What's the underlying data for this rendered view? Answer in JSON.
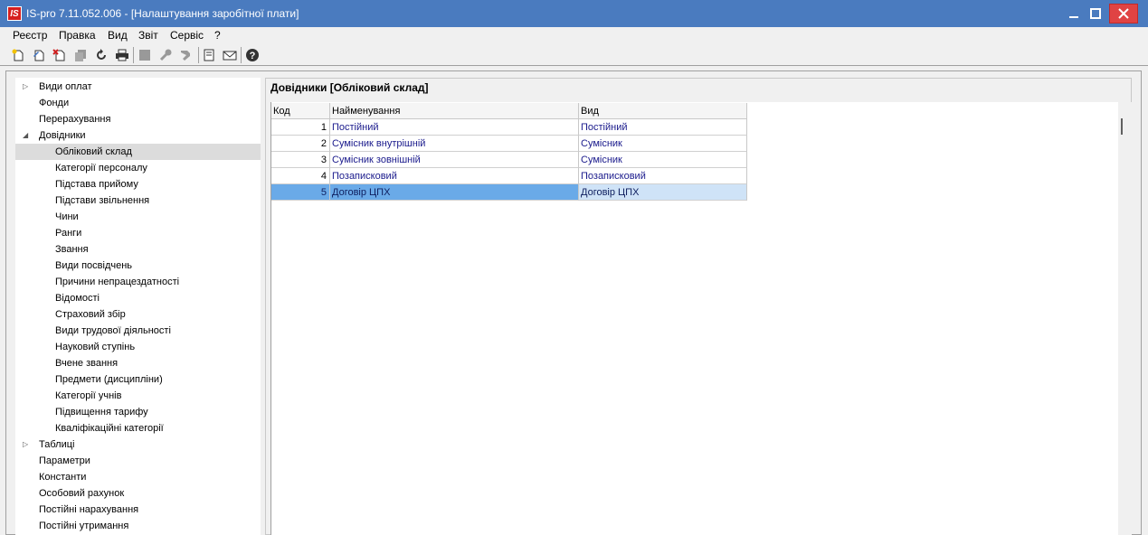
{
  "window": {
    "logo": "IS",
    "title": "IS-pro 7.11.052.006 - [Налаштування заробітної плати]"
  },
  "menu": [
    "Реєстр",
    "Правка",
    "Вид",
    "Звіт",
    "Сервіс",
    "?"
  ],
  "toolbar": {
    "icons": [
      "new-doc-icon",
      "edit-doc-icon",
      "delete-doc-icon",
      "copy-icon",
      "refresh-icon",
      "print-icon",
      "square-icon",
      "wrench-icon",
      "tool-icon",
      "document-icon",
      "envelope-icon",
      "help-icon"
    ]
  },
  "tree": {
    "items": [
      {
        "label": "Види оплат",
        "level": 0,
        "expander": "collapsed"
      },
      {
        "label": "Фонди",
        "level": 0,
        "expander": "none"
      },
      {
        "label": "Перерахування",
        "level": 0,
        "expander": "none"
      },
      {
        "label": "Довідники",
        "level": 0,
        "expander": "expanded"
      },
      {
        "label": "Обліковий склад",
        "level": 1,
        "expander": "none",
        "selected": true
      },
      {
        "label": "Категорії персоналу",
        "level": 1,
        "expander": "none"
      },
      {
        "label": "Підстава прийому",
        "level": 1,
        "expander": "none"
      },
      {
        "label": "Підстави звільнення",
        "level": 1,
        "expander": "none"
      },
      {
        "label": "Чини",
        "level": 1,
        "expander": "none"
      },
      {
        "label": "Ранги",
        "level": 1,
        "expander": "none"
      },
      {
        "label": "Звання",
        "level": 1,
        "expander": "none"
      },
      {
        "label": "Види посвідчень",
        "level": 1,
        "expander": "none"
      },
      {
        "label": "Причини непрацездатності",
        "level": 1,
        "expander": "none"
      },
      {
        "label": "Відомості",
        "level": 1,
        "expander": "none"
      },
      {
        "label": "Страховий збір",
        "level": 1,
        "expander": "none"
      },
      {
        "label": "Види трудової діяльності",
        "level": 1,
        "expander": "none"
      },
      {
        "label": "Науковий ступінь",
        "level": 1,
        "expander": "none"
      },
      {
        "label": "Вчене звання",
        "level": 1,
        "expander": "none"
      },
      {
        "label": "Предмети (дисципліни)",
        "level": 1,
        "expander": "none"
      },
      {
        "label": "Категорії учнів",
        "level": 1,
        "expander": "none"
      },
      {
        "label": "Підвищення тарифу",
        "level": 1,
        "expander": "none"
      },
      {
        "label": "Кваліфікаційні категорії",
        "level": 1,
        "expander": "none"
      },
      {
        "label": "Таблиці",
        "level": 0,
        "expander": "collapsed"
      },
      {
        "label": "Параметри",
        "level": 0,
        "expander": "none"
      },
      {
        "label": "Константи",
        "level": 0,
        "expander": "none"
      },
      {
        "label": "Особовий рахунок",
        "level": 0,
        "expander": "none"
      },
      {
        "label": "Постійні нарахування",
        "level": 0,
        "expander": "none"
      },
      {
        "label": "Постійні утримання",
        "level": 0,
        "expander": "none"
      }
    ]
  },
  "panel": {
    "title": "Довідники [Обліковий склад]"
  },
  "table": {
    "columns": [
      "Код",
      "Найменування",
      "Вид"
    ],
    "rows": [
      {
        "code": "1",
        "name": "Постійний",
        "kind": "Постійний",
        "selected": false
      },
      {
        "code": "2",
        "name": "Сумісник  внутрішній",
        "kind": "Сумісник",
        "selected": false
      },
      {
        "code": "3",
        "name": "Сумісник зовнішній",
        "kind": "Сумісник",
        "selected": false
      },
      {
        "code": "4",
        "name": "Позаписковий",
        "kind": "Позаписковий",
        "selected": false
      },
      {
        "code": "5",
        "name": "Договір ЦПХ",
        "kind": "Договір ЦПХ",
        "selected": true
      }
    ]
  },
  "colors": {
    "titlebar": "#4a7bbf",
    "close_button": "#e04343",
    "selection": "#6aaae8",
    "tree_selection": "#dcdcdc"
  }
}
